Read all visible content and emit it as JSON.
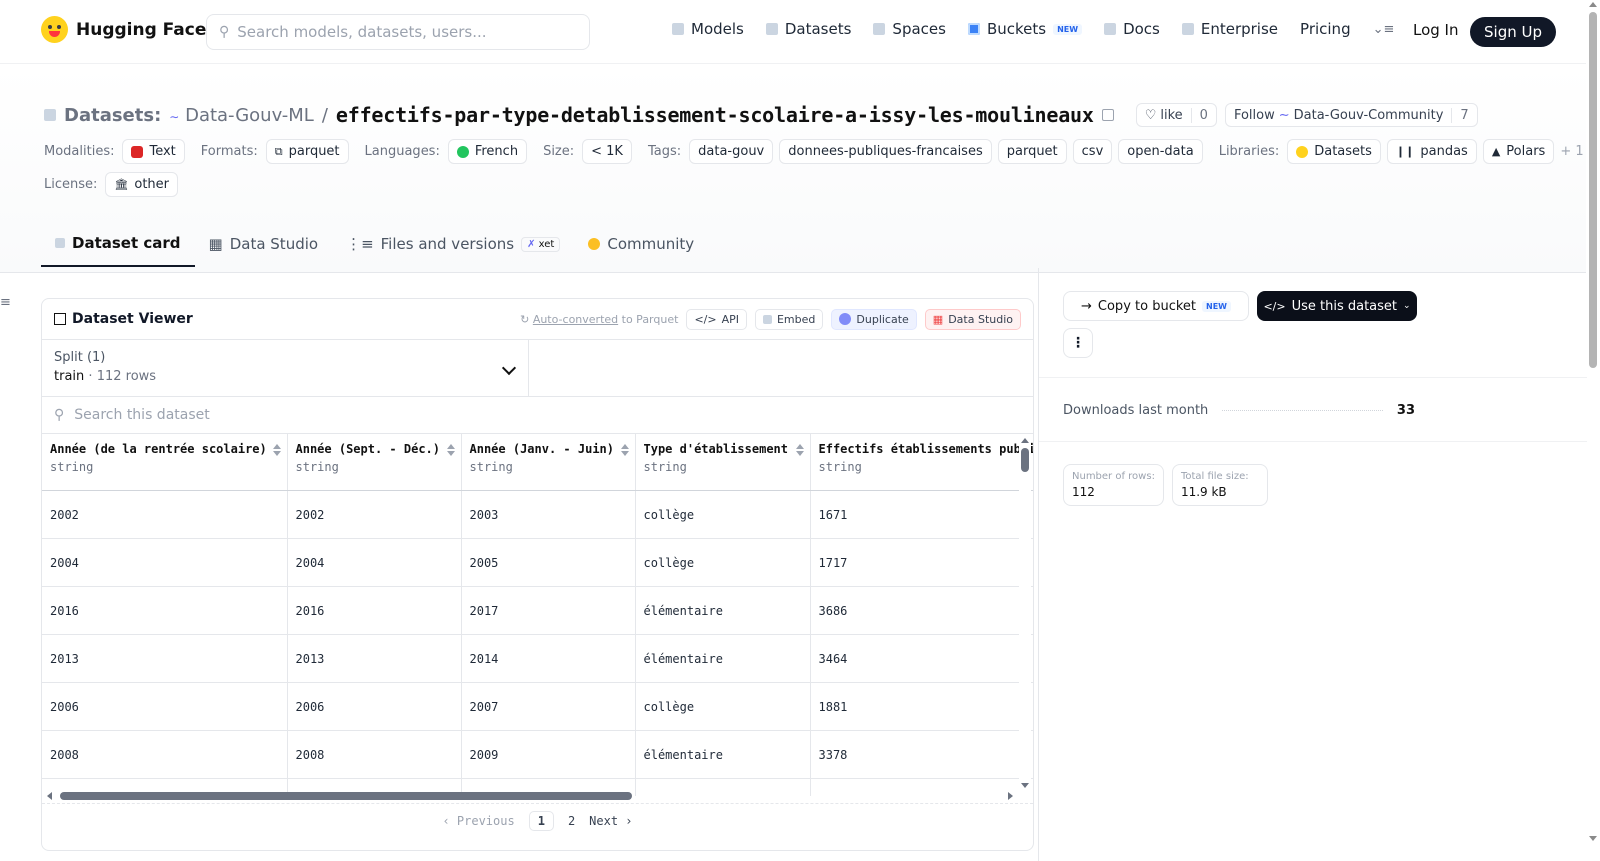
{
  "nav": {
    "brand": "Hugging Face",
    "search_placeholder": "Search models, datasets, users...",
    "links": [
      "Models",
      "Datasets",
      "Spaces",
      "Buckets",
      "Docs",
      "Enterprise",
      "Pricing"
    ],
    "buckets_badge": "NEW",
    "login": "Log In",
    "signup": "Sign Up"
  },
  "header": {
    "datasets_label": "Datasets:",
    "owner": "Data-Gouv-ML",
    "separator": "/",
    "name": "effectifs-par-type-detablissement-scolaire-a-issy-les-moulineaux",
    "like_label": "like",
    "like_count": "0",
    "follow_label": "Follow",
    "follow_org": "Data-Gouv-Community",
    "follow_count": "7"
  },
  "meta": {
    "modalities_label": "Modalities:",
    "modality": "Text",
    "formats_label": "Formats:",
    "format": "parquet",
    "languages_label": "Languages:",
    "language": "French",
    "size_label": "Size:",
    "size": "< 1K",
    "tags_label": "Tags:",
    "tags": [
      "data-gouv",
      "donnees-publiques-francaises",
      "parquet",
      "csv",
      "open-data"
    ],
    "libraries_label": "Libraries:",
    "libraries": [
      "Datasets",
      "pandas",
      "Polars"
    ],
    "libraries_more": "+ 1",
    "license_label": "License:",
    "license": "other"
  },
  "tabs": {
    "card": "Dataset card",
    "studio": "Data Studio",
    "files": "Files and versions",
    "xet": "xet",
    "community": "Community"
  },
  "viewer": {
    "title": "Dataset Viewer",
    "auto_converted": "Auto-converted",
    "to_parquet": "to Parquet",
    "api": "API",
    "embed": "Embed",
    "duplicate": "Duplicate",
    "data_studio": "Data Studio",
    "split_label": "Split (1)",
    "split_value": "train",
    "split_dot": "·",
    "split_rows": "112 rows",
    "search_placeholder": "Search this dataset",
    "columns": [
      {
        "name": "Année (de la rentrée scolaire)",
        "type": "string"
      },
      {
        "name": "Année (Sept. - Déc.)",
        "type": "string"
      },
      {
        "name": "Année (Janv. - Juin)",
        "type": "string"
      },
      {
        "name": "Type d'établissement",
        "type": "string"
      },
      {
        "name": "Effectifs établissements publics",
        "type": "string"
      }
    ],
    "rows": [
      [
        "2002",
        "2002",
        "2003",
        "collège",
        "1671"
      ],
      [
        "2004",
        "2004",
        "2005",
        "collège",
        "1717"
      ],
      [
        "2016",
        "2016",
        "2017",
        "élémentaire",
        "3686"
      ],
      [
        "2013",
        "2013",
        "2014",
        "élémentaire",
        "3464"
      ],
      [
        "2006",
        "2006",
        "2007",
        "collège",
        "1881"
      ],
      [
        "2008",
        "2008",
        "2009",
        "élémentaire",
        "3378"
      ]
    ],
    "pager": {
      "prev": "Previous",
      "p1": "1",
      "p2": "2",
      "next": "Next"
    }
  },
  "sidebar": {
    "copy_bucket": "Copy to bucket",
    "copy_badge": "NEW",
    "use_dataset": "Use this dataset",
    "downloads_label": "Downloads last month",
    "downloads": "33",
    "rows_label": "Number of rows:",
    "rows": "112",
    "size_label": "Total file size:",
    "size": "11.9 kB"
  },
  "colors": {
    "accent_dark": "#0b0f19",
    "brand_yellow": "#ffd21e",
    "link_blue": "#2563eb"
  }
}
